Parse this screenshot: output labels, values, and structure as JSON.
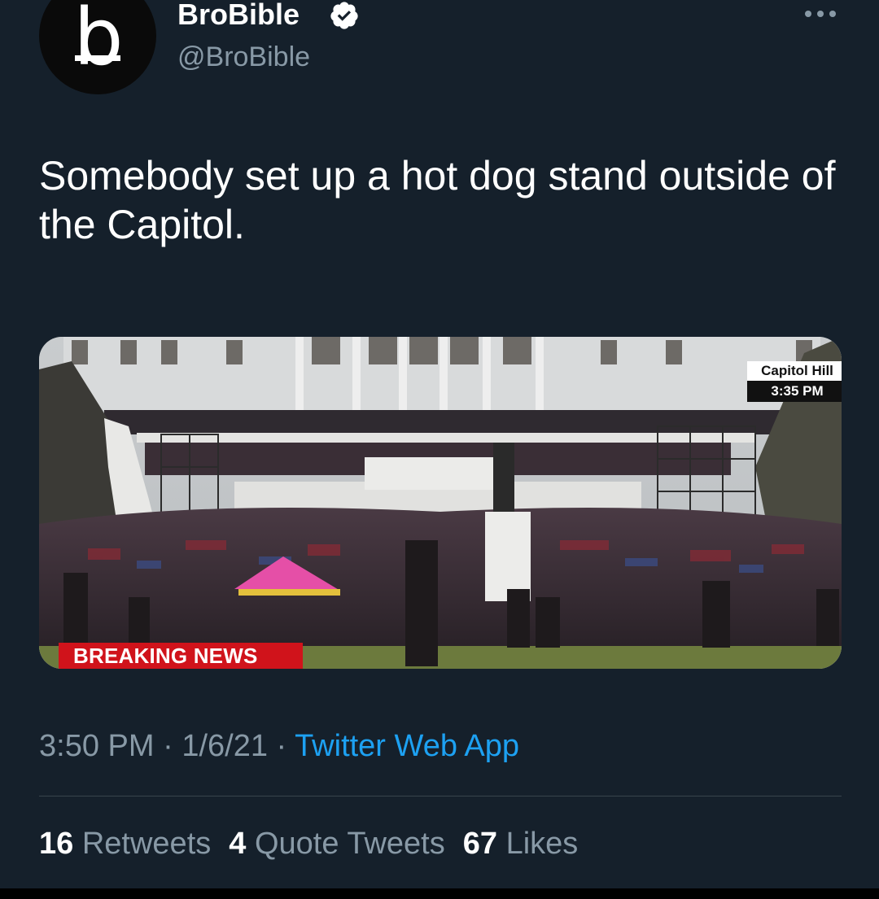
{
  "account": {
    "display_name": "BroBible",
    "handle": "@BroBible",
    "avatar_letter": "b",
    "verified": true
  },
  "tweet": {
    "text": "Somebody set up a hot dog stand outside of the Capitol."
  },
  "media": {
    "location_label": "Capitol Hill",
    "time_label": "3:35 PM",
    "banner": "BREAKING NEWS"
  },
  "meta": {
    "time": "3:50 PM",
    "sep1": " · ",
    "date": "1/6/21",
    "sep2": " · ",
    "source": "Twitter Web App"
  },
  "stats": {
    "retweets_count": "16",
    "retweets_label": "Retweets",
    "quotes_count": "4",
    "quotes_label": "Quote Tweets",
    "likes_count": "67",
    "likes_label": "Likes"
  },
  "colors": {
    "background": "#15202b",
    "secondary_text": "#8899a6",
    "link": "#1da1f2",
    "breaking_red": "#d0131b"
  },
  "icons": {
    "verified": "verified-badge-icon",
    "more": "more-options-icon"
  }
}
